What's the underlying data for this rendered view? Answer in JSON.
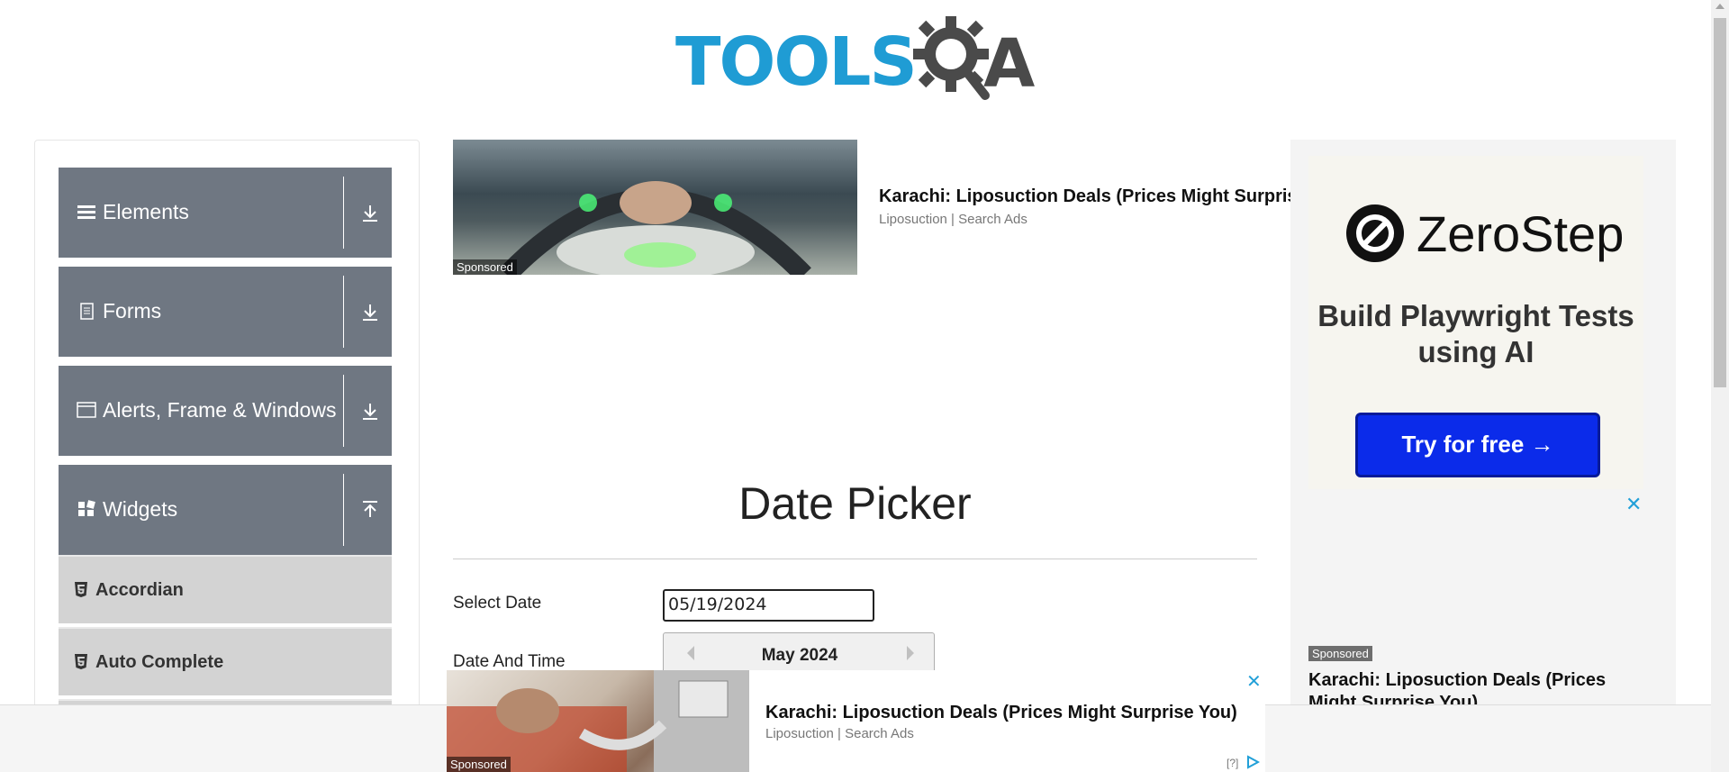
{
  "header": {
    "logo_text": "TOOLS",
    "logo_suffix": "A"
  },
  "sidebar": {
    "groups": [
      {
        "label": "Elements",
        "icon": "hamburger-icon",
        "expanded": false
      },
      {
        "label": "Forms",
        "icon": "document-icon",
        "expanded": false
      },
      {
        "label": "Alerts, Frame & Windows",
        "icon": "window-icon",
        "expanded": false
      },
      {
        "label": "Widgets",
        "icon": "widgets-icon",
        "expanded": true
      }
    ],
    "items": [
      {
        "label": "Accordian",
        "icon": "html5-icon"
      },
      {
        "label": "Auto Complete",
        "icon": "html5-icon"
      }
    ]
  },
  "ad_top": {
    "title": "Karachi: Liposuction Deals (Prices Might Surprise You)",
    "subtitle": "Liposuction | Search Ads",
    "sponsored": "Sponsored"
  },
  "ad_right": {
    "brand": "ZeroStep",
    "tagline": "Build Playwright Tests using AI",
    "button": "Try for free →",
    "close": "✕",
    "sponsored": "Sponsored",
    "title": "Karachi: Liposuction Deals (Prices Might Surprise You)"
  },
  "main": {
    "page_title": "Date Picker",
    "select_date_label": "Select Date",
    "date_time_label": "Date And Time",
    "select_date_value": "05/19/2024",
    "calendar_month": "May 2024"
  },
  "ad_bottom": {
    "title": "Karachi: Liposuction Deals (Prices Might Surprise You)",
    "subtitle": "Liposuction | Search Ads",
    "sponsored": "Sponsored",
    "close": "✕",
    "help": "[?]"
  },
  "colors": {
    "brand_blue": "#1f9cd4",
    "sidebar_header": "#6f7782",
    "sidebar_item": "#d3d3d3",
    "cta_blue": "#0b2bea"
  }
}
